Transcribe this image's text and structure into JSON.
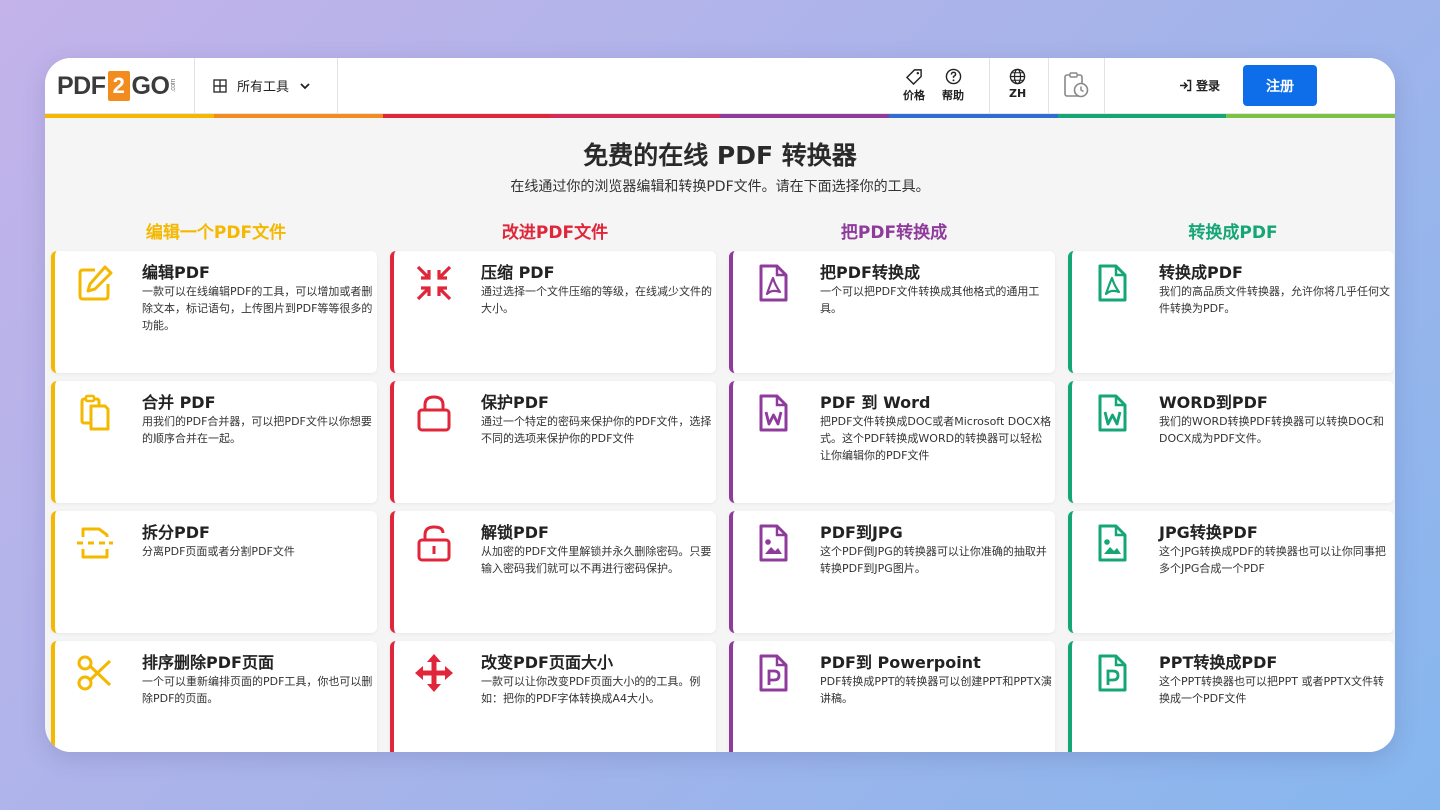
{
  "header": {
    "logo": {
      "pdf": "PDF",
      "two": "2",
      "go": "GO",
      "com": ".com"
    },
    "all_tools": "所有工具",
    "price": "价格",
    "help": "帮助",
    "lang": "ZH",
    "login": "登录",
    "register": "注册"
  },
  "colors": {
    "yellow": "#f5b800",
    "red": "#e0263a",
    "purple": "#8e3b9c",
    "green": "#14a676",
    "blue": "#0e6eea",
    "rainbow": [
      "#f5b800",
      "#f28c1e",
      "#e0263a",
      "#d22c5a",
      "#8e3b9c",
      "#2f6ed0",
      "#14a676",
      "#7cc243"
    ]
  },
  "hero": {
    "title": "免费的在线 PDF 转换器",
    "subtitle": "在线通过你的浏览器编辑和转换PDF文件。请在下面选择你的工具。"
  },
  "columns": [
    {
      "heading": "编辑一个PDF文件",
      "cards": [
        {
          "icon": "edit-icon",
          "title": "编辑PDF",
          "desc": "一款可以在线编辑PDF的工具，可以增加或者删除文本，标记语句，上传图片到PDF等等很多的功能。"
        },
        {
          "icon": "merge-icon",
          "title": "合并 PDF",
          "desc": "用我们的PDF合并器，可以把PDF文件以你想要的顺序合并在一起。"
        },
        {
          "icon": "split-icon",
          "title": "拆分PDF",
          "desc": "分离PDF页面或者分割PDF文件"
        },
        {
          "icon": "scissors-icon",
          "title": "排序删除PDF页面",
          "desc": "一个可以重新编排页面的PDF工具，你也可以删除PDF的页面。"
        }
      ]
    },
    {
      "heading": "改进PDF文件",
      "cards": [
        {
          "icon": "compress-icon",
          "title": "压缩 PDF",
          "desc": "通过选择一个文件压缩的等级，在线减少文件的大小。"
        },
        {
          "icon": "lock-icon",
          "title": "保护PDF",
          "desc": "通过一个特定的密码来保护你的PDF文件，选择不同的选项来保护你的PDF文件"
        },
        {
          "icon": "unlock-icon",
          "title": "解锁PDF",
          "desc": "从加密的PDF文件里解锁并永久删除密码。只要输入密码我们就可以不再进行密码保护。"
        },
        {
          "icon": "resize-arrows-icon",
          "title": "改变PDF页面大小",
          "desc": "一款可以让你改变PDF页面大小的的工具。例如：把你的PDF字体转换成A4大小。"
        }
      ]
    },
    {
      "heading": "把PDF转换成",
      "cards": [
        {
          "icon": "pdf-file-icon",
          "title": "把PDF转换成",
          "desc": "一个可以把PDF文件转换成其他格式的通用工具。"
        },
        {
          "icon": "word-file-icon",
          "title": "PDF 到 Word",
          "desc": "把PDF文件转换成DOC或者Microsoft DOCX格式。这个PDF转换成WORD的转换器可以轻松让你编辑你的PDF文件"
        },
        {
          "icon": "image-file-icon",
          "title": "PDF到JPG",
          "desc": "这个PDF倒JPG的转换器可以让你准确的抽取并转换PDF到JPG图片。"
        },
        {
          "icon": "ppt-file-icon",
          "title": "PDF到 Powerpoint",
          "desc": "PDF转换成PPT的转换器可以创建PPT和PPTX演讲稿。"
        }
      ]
    },
    {
      "heading": "转换成PDF",
      "cards": [
        {
          "icon": "pdf-file-icon",
          "title": "转换成PDF",
          "desc": "我们的高品质文件转换器，允许你将几乎任何文件转换为PDF。"
        },
        {
          "icon": "word-file-icon",
          "title": "WORD到PDF",
          "desc": "我们的WORD转换PDF转换器可以转换DOC和DOCX成为PDF文件。"
        },
        {
          "icon": "image-file-icon",
          "title": "JPG转换PDF",
          "desc": "这个JPG转换成PDF的转换器也可以让你同事把多个JPG合成一个PDF"
        },
        {
          "icon": "ppt-file-icon",
          "title": "PPT转换成PDF",
          "desc": "这个PPT转换器也可以把PPT 或者PPTX文件转换成一个PDF文件"
        }
      ]
    }
  ]
}
